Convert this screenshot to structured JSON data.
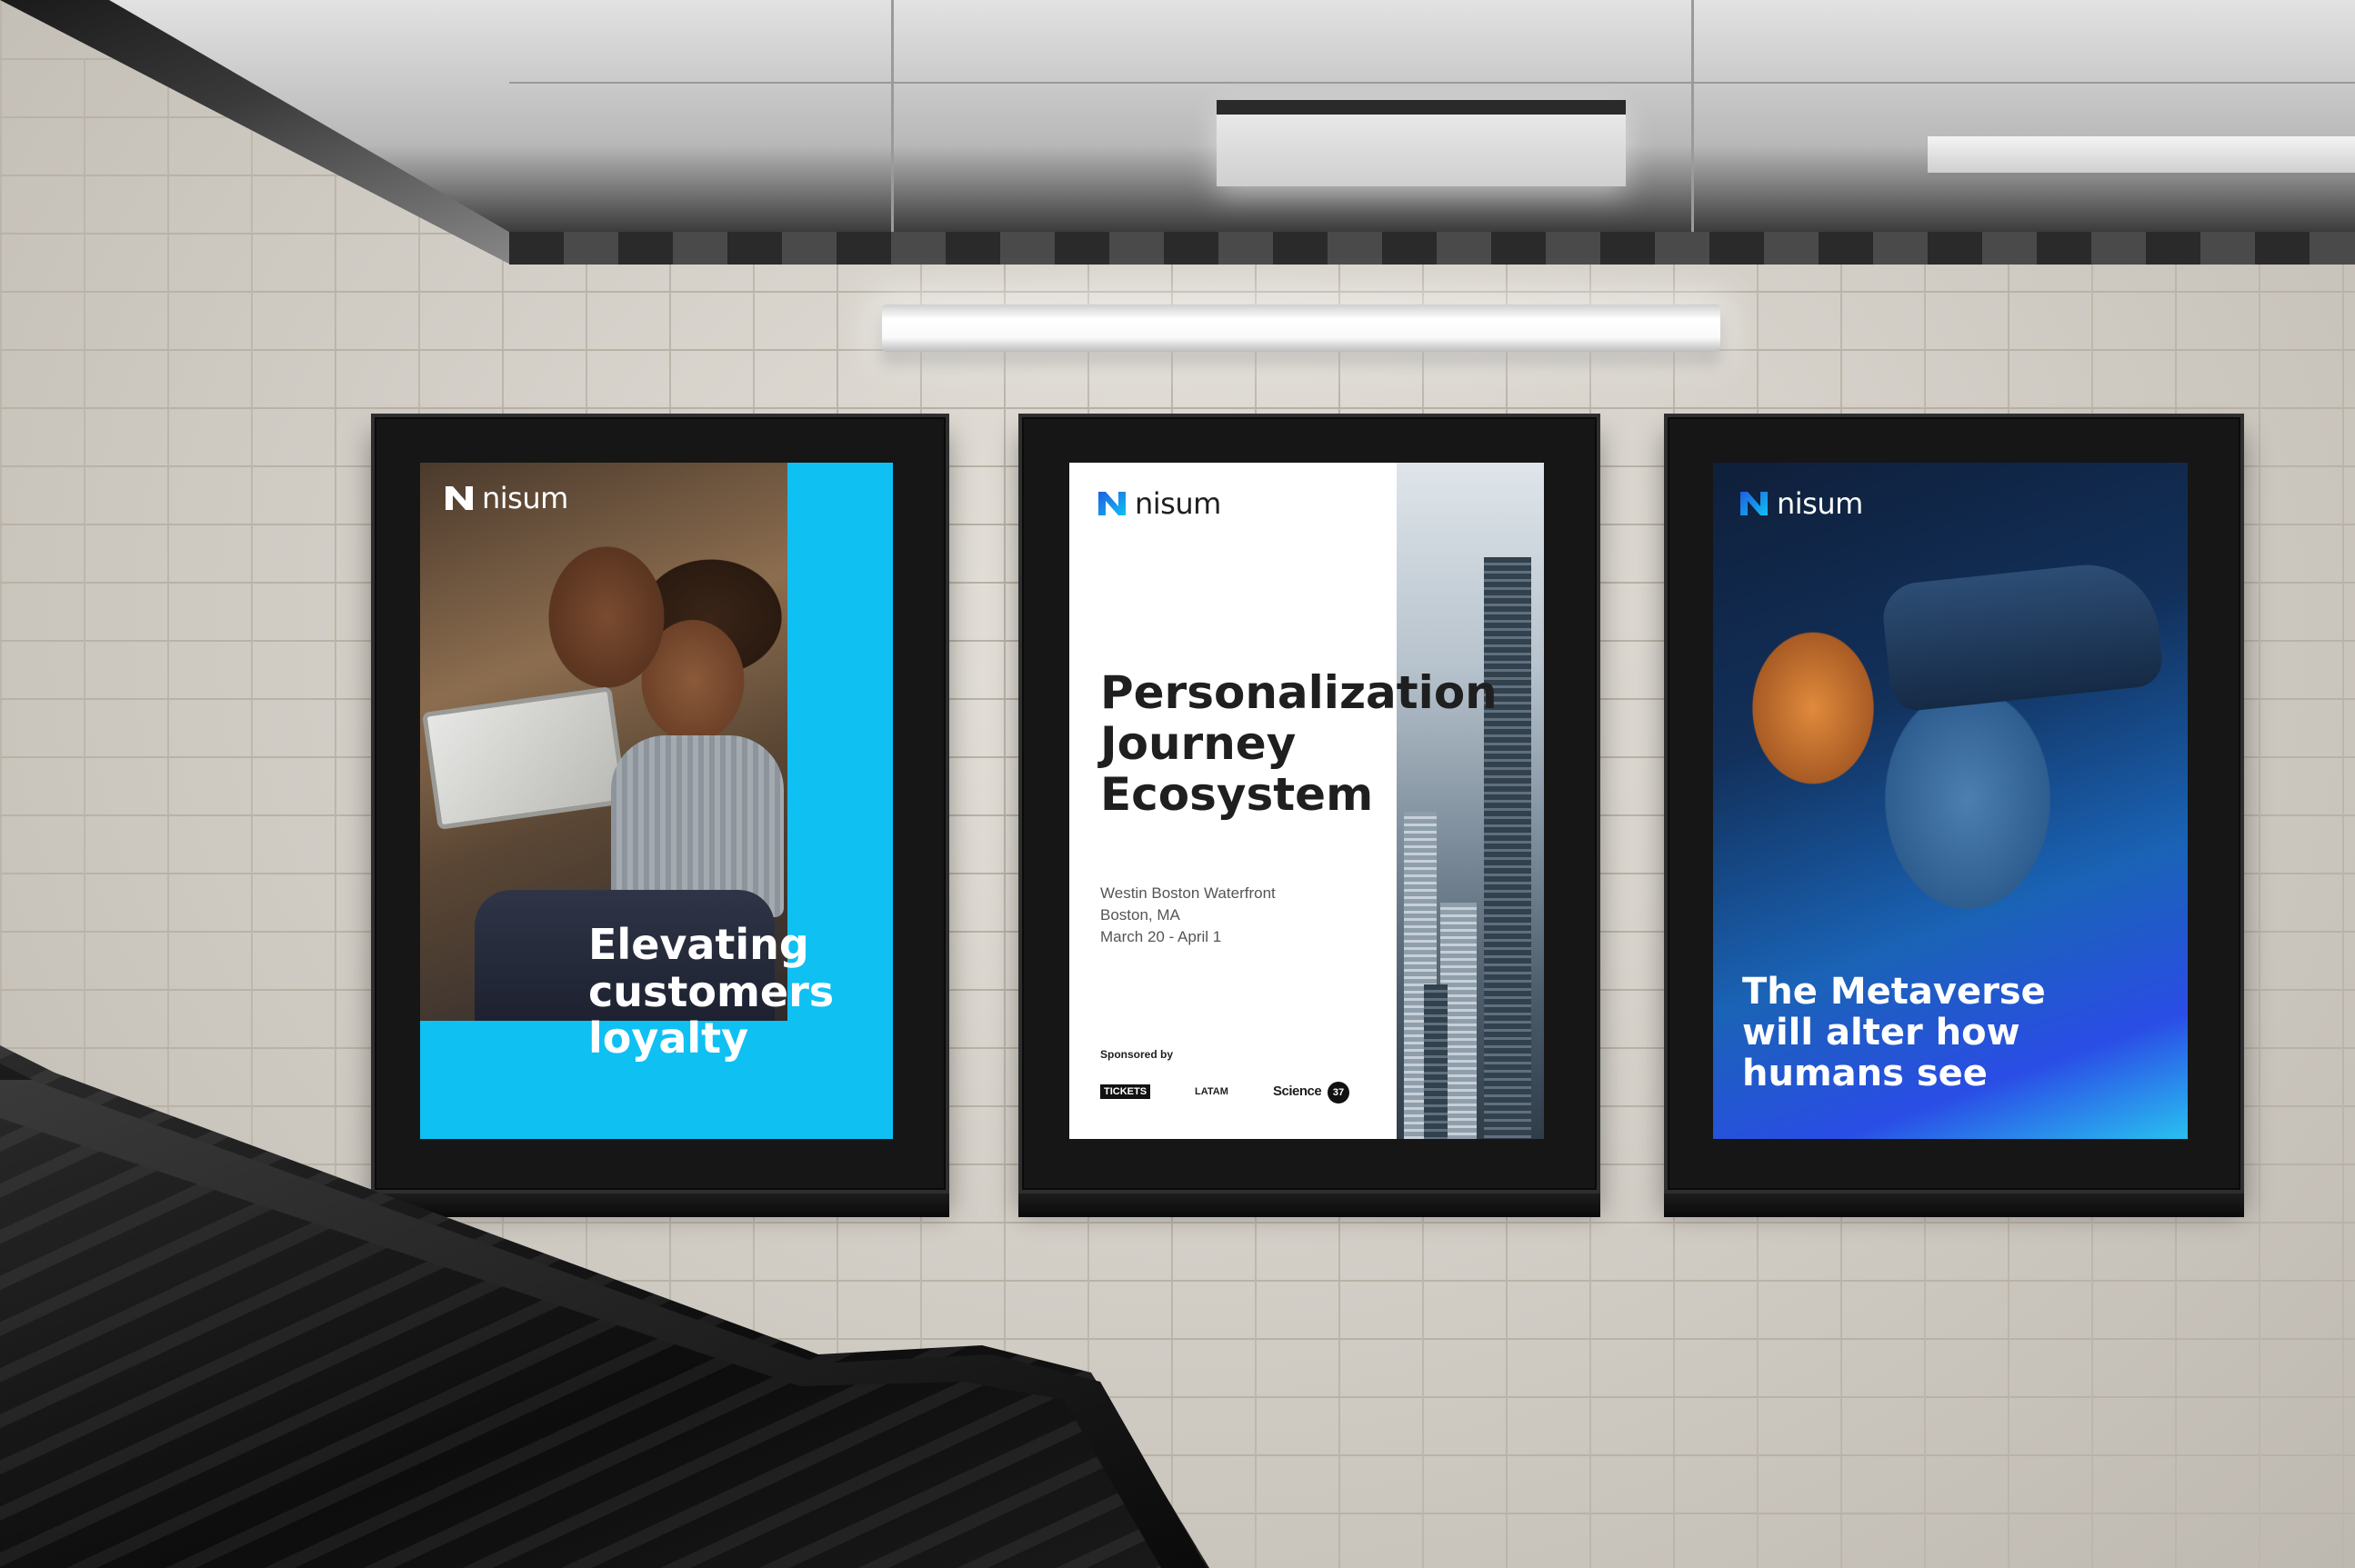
{
  "colors": {
    "brand_cyan": "#0fc0f3",
    "brand_blue": "#1f5fe0",
    "text_dark": "#1f1f1f",
    "text_white": "#ffffff"
  },
  "posters": [
    {
      "logo": "nisum",
      "headline": [
        "Elevating",
        "customers",
        "loyalty"
      ]
    },
    {
      "logo": "nisum",
      "headline": [
        "Personalization",
        "Journey",
        "Ecosystem"
      ],
      "details": [
        "Westin Boston Waterfront",
        "Boston, MA",
        "March 20 - April 1"
      ],
      "sponsored_by": "Sponsored by",
      "sponsors": [
        "TICKETS",
        "LATAM",
        "Science",
        "37"
      ]
    },
    {
      "logo": "nisum",
      "headline": [
        "The Metaverse",
        "will alter how",
        "humans see"
      ]
    }
  ]
}
